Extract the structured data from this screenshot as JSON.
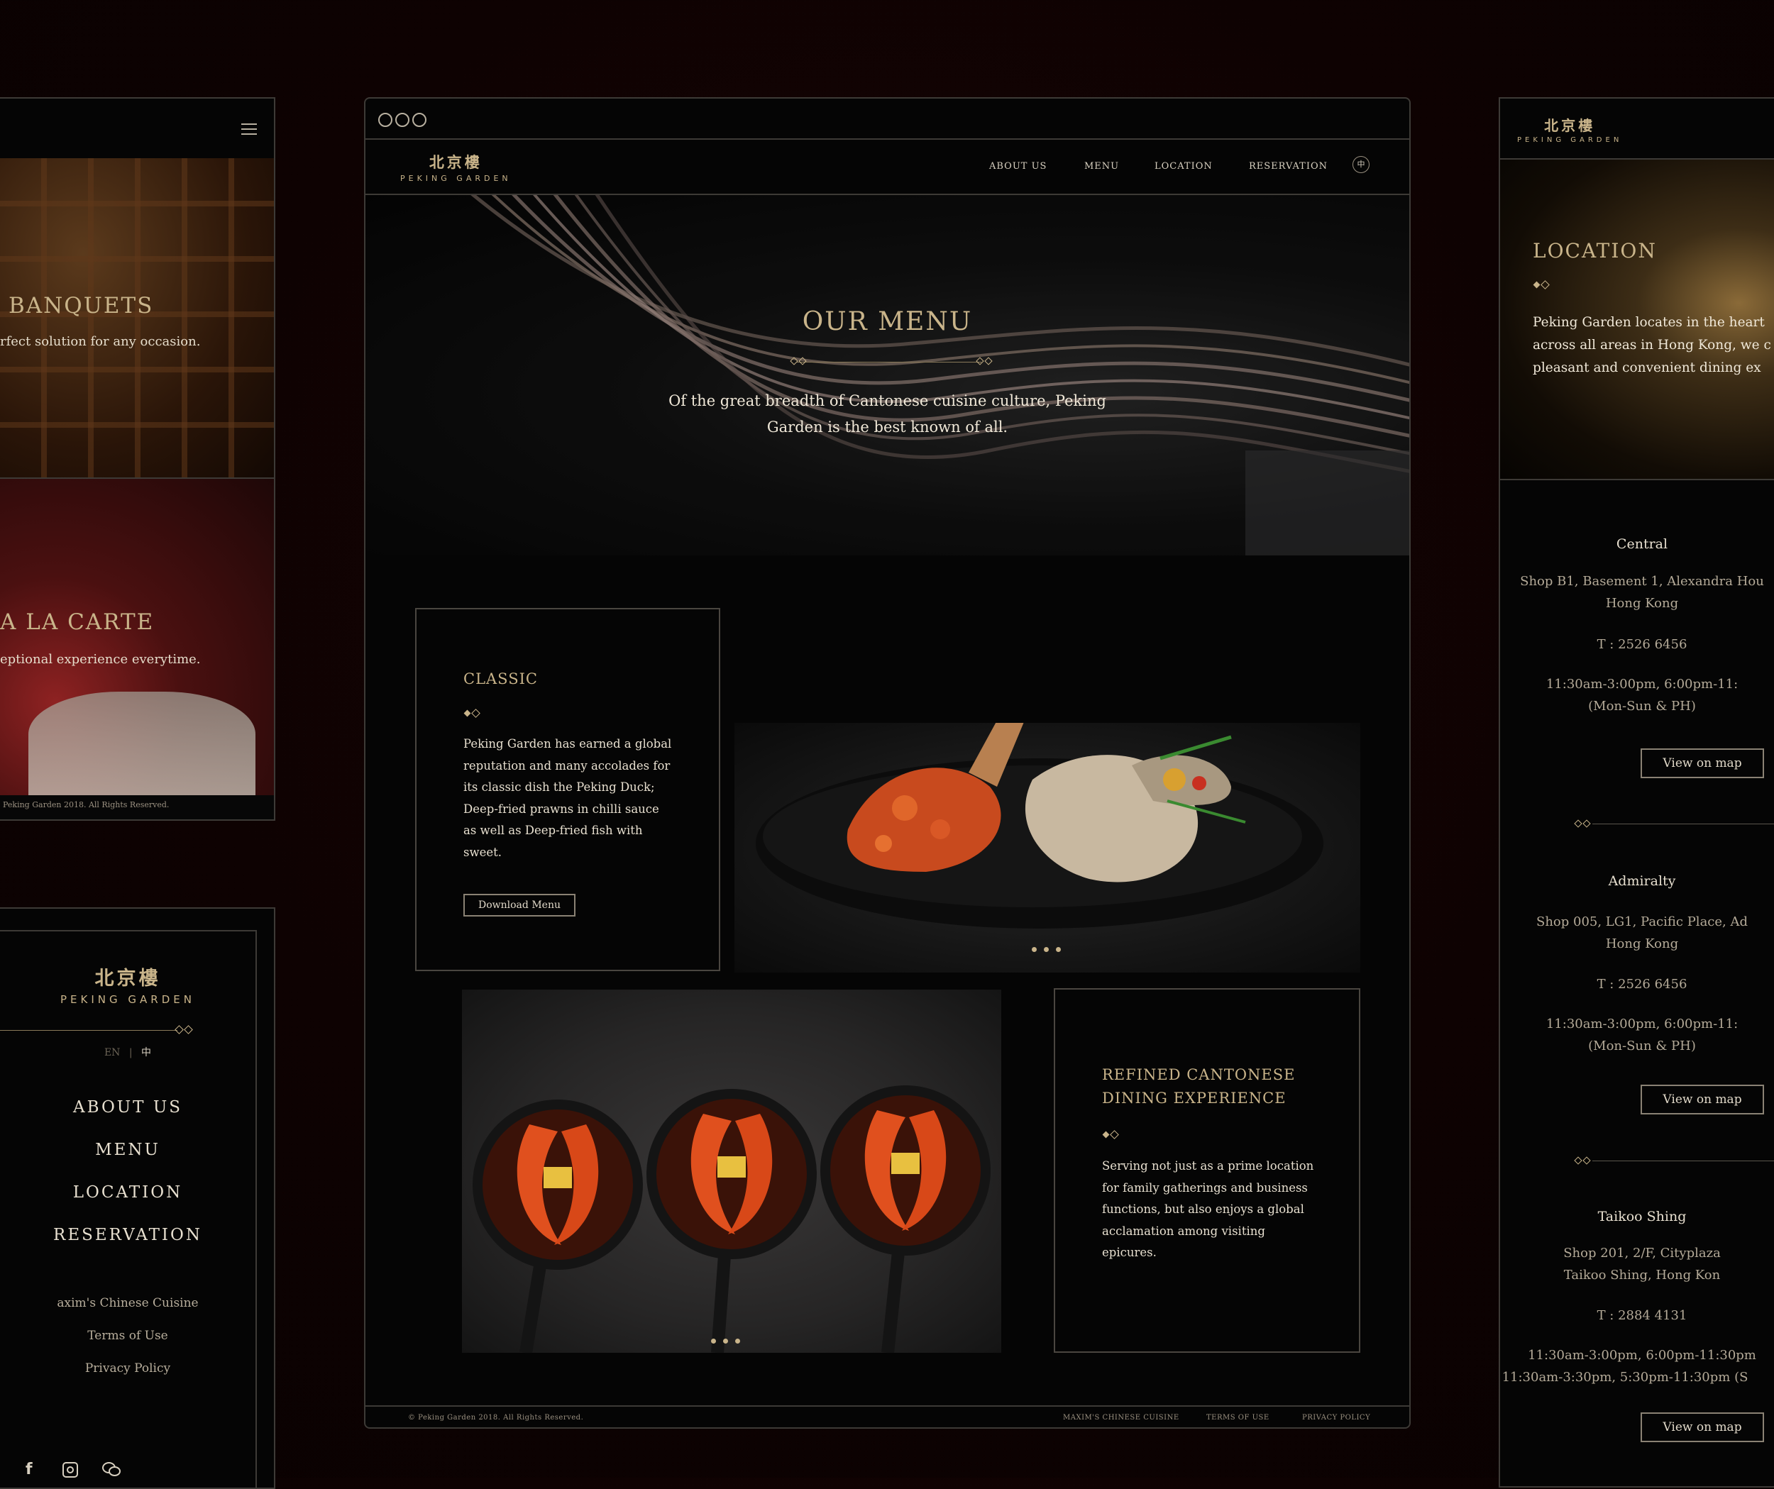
{
  "brand": {
    "cn": "北京樓",
    "en": "PEKING GARDEN"
  },
  "mobile_left": {
    "banquets": {
      "title": "BANQUETS",
      "text": "rfect solution for any occasion."
    },
    "alacarte": {
      "title": "A LA CARTE",
      "text": "eptional experience everytime."
    },
    "footer": "Peking Garden 2018. All Rights Reserved."
  },
  "mobile_menu": {
    "lang_en": "EN",
    "lang_divider": "|",
    "lang_cn": "中",
    "nav": [
      "ABOUT US",
      "MENU",
      "LOCATION",
      "RESERVATION"
    ],
    "links": [
      "axim's Chinese Cuisine",
      "Terms of Use",
      "Privacy Policy"
    ],
    "social": [
      "facebook-icon",
      "instagram-icon",
      "wechat-icon"
    ]
  },
  "browser": {
    "nav": [
      "ABOUT US",
      "MENU",
      "LOCATION",
      "RESERVATION"
    ],
    "lang_icon": "中",
    "hero": {
      "title": "OUR MENU",
      "text1": "Of the great breadth of Cantonese cuisine culture, Peking",
      "text2": "Garden is the best known of all."
    },
    "classic": {
      "title": "CLASSIC",
      "lines": [
        "Peking Garden has earned a global",
        "reputation and many accolades for",
        "its classic dish the Peking Duck;",
        "Deep-fried prawns in chilli sauce",
        "as well as Deep-fried fish with",
        "sweet."
      ],
      "button": "Download Menu"
    },
    "refined": {
      "title1": "REFINED CANTONESE",
      "title2": "DINING EXPERIENCE",
      "lines": [
        "Serving not just as a prime location",
        "for family gatherings and business",
        "functions, but also enjoys a global",
        "acclamation among visiting",
        "epicures."
      ]
    },
    "footer": {
      "copyright": "© Peking Garden 2018. All Rights Reserved.",
      "links": [
        "MAXIM'S CHINESE CUISINE",
        "TERMS OF USE",
        "PRIVACY POLICY"
      ]
    }
  },
  "mobile_right": {
    "title": "LOCATION",
    "intro": [
      "Peking Garden locates in the heart",
      "across all areas in Hong Kong, we c",
      "pleasant and convenient dining ex"
    ],
    "locations": [
      {
        "name": "Central",
        "addr1": "Shop B1, Basement 1, Alexandra Hou",
        "addr2": "Hong Kong",
        "tel": "T : 2526 6456",
        "hours1": "11:30am-3:00pm, 6:00pm-11:",
        "hours2": "(Mon-Sun & PH)",
        "button": "View on map"
      },
      {
        "name": "Admiralty",
        "addr1": "Shop 005, LG1, Pacific Place, Ad",
        "addr2": "Hong Kong",
        "tel": "T : 2526 6456",
        "hours1": "11:30am-3:00pm, 6:00pm-11:",
        "hours2": "(Mon-Sun & PH)",
        "button": "View on map"
      },
      {
        "name": "Taikoo Shing",
        "addr1": "Shop 201, 2/F, Cityplaza",
        "addr2": "Taikoo Shing, Hong Kon",
        "tel": "T : 2884 4131",
        "hours1": "11:30am-3:00pm, 6:00pm-11:30pm",
        "hours2": "11:30am-3:30pm, 5:30pm-11:30pm (S",
        "button": "View on map"
      }
    ]
  },
  "colors": {
    "gold": "#c9b48a",
    "background": "#0e0202",
    "panel": "#050505",
    "border": "#3d3a36"
  }
}
